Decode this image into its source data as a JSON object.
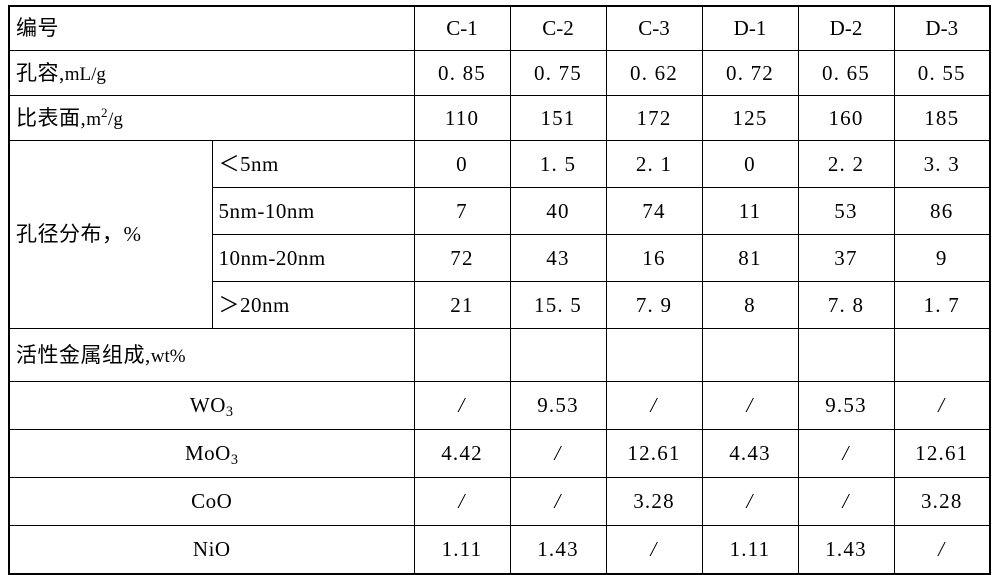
{
  "table": {
    "columns": [
      "C-1",
      "C-2",
      "C-3",
      "D-1",
      "D-2",
      "D-3"
    ],
    "header_label": "编号",
    "rows": {
      "pore_volume": {
        "label_cn": "孔容,",
        "label_unit": "mL/g",
        "values": [
          "0. 85",
          "0. 75",
          "0. 62",
          "0. 72",
          "0. 65",
          "0. 55"
        ]
      },
      "surface_area": {
        "label_cn": "比表面,",
        "label_unit_pre": "m",
        "label_unit_sup": "2",
        "label_unit_post": "/g",
        "values": [
          "110",
          "151",
          "172",
          "125",
          "160",
          "185"
        ]
      },
      "pore_distribution": {
        "group_label": "孔径分布，%",
        "sub_rows": [
          {
            "label": "＜5nm",
            "values": [
              "0",
              "1. 5",
              "2. 1",
              "0",
              "2. 2",
              "3. 3"
            ]
          },
          {
            "label": "5nm-10nm",
            "values": [
              "7",
              "40",
              "74",
              "11",
              "53",
              "86"
            ]
          },
          {
            "label": "10nm-20nm",
            "values": [
              "72",
              "43",
              "16",
              "81",
              "37",
              "9"
            ]
          },
          {
            "label": "＞20nm",
            "values": [
              "21",
              "15. 5",
              "7. 9",
              "8",
              "7. 8",
              "1. 7"
            ]
          }
        ]
      },
      "active_metal": {
        "group_label_cn": "活性金属组成,",
        "group_label_unit": "wt%",
        "group_values": [
          "",
          "",
          "",
          "",
          "",
          ""
        ],
        "sub_rows": [
          {
            "label_main": "WO",
            "label_sub": "3",
            "values": [
              "/",
              "9.53",
              "/",
              "/",
              "9.53",
              "/"
            ]
          },
          {
            "label_main": "MoO",
            "label_sub": "3",
            "values": [
              "4.42",
              "/",
              "12.61",
              "4.43",
              "/",
              "12.61"
            ]
          },
          {
            "label_main": "CoO",
            "label_sub": "",
            "values": [
              "/",
              "/",
              "3.28",
              "/",
              "/",
              "3.28"
            ]
          },
          {
            "label_main": "NiO",
            "label_sub": "",
            "values": [
              "1.11",
              "1.43",
              "/",
              "1.11",
              "1.43",
              "/"
            ]
          }
        ]
      }
    }
  },
  "colors": {
    "border": "#000000",
    "text": "#000000",
    "background": "#ffffff"
  }
}
